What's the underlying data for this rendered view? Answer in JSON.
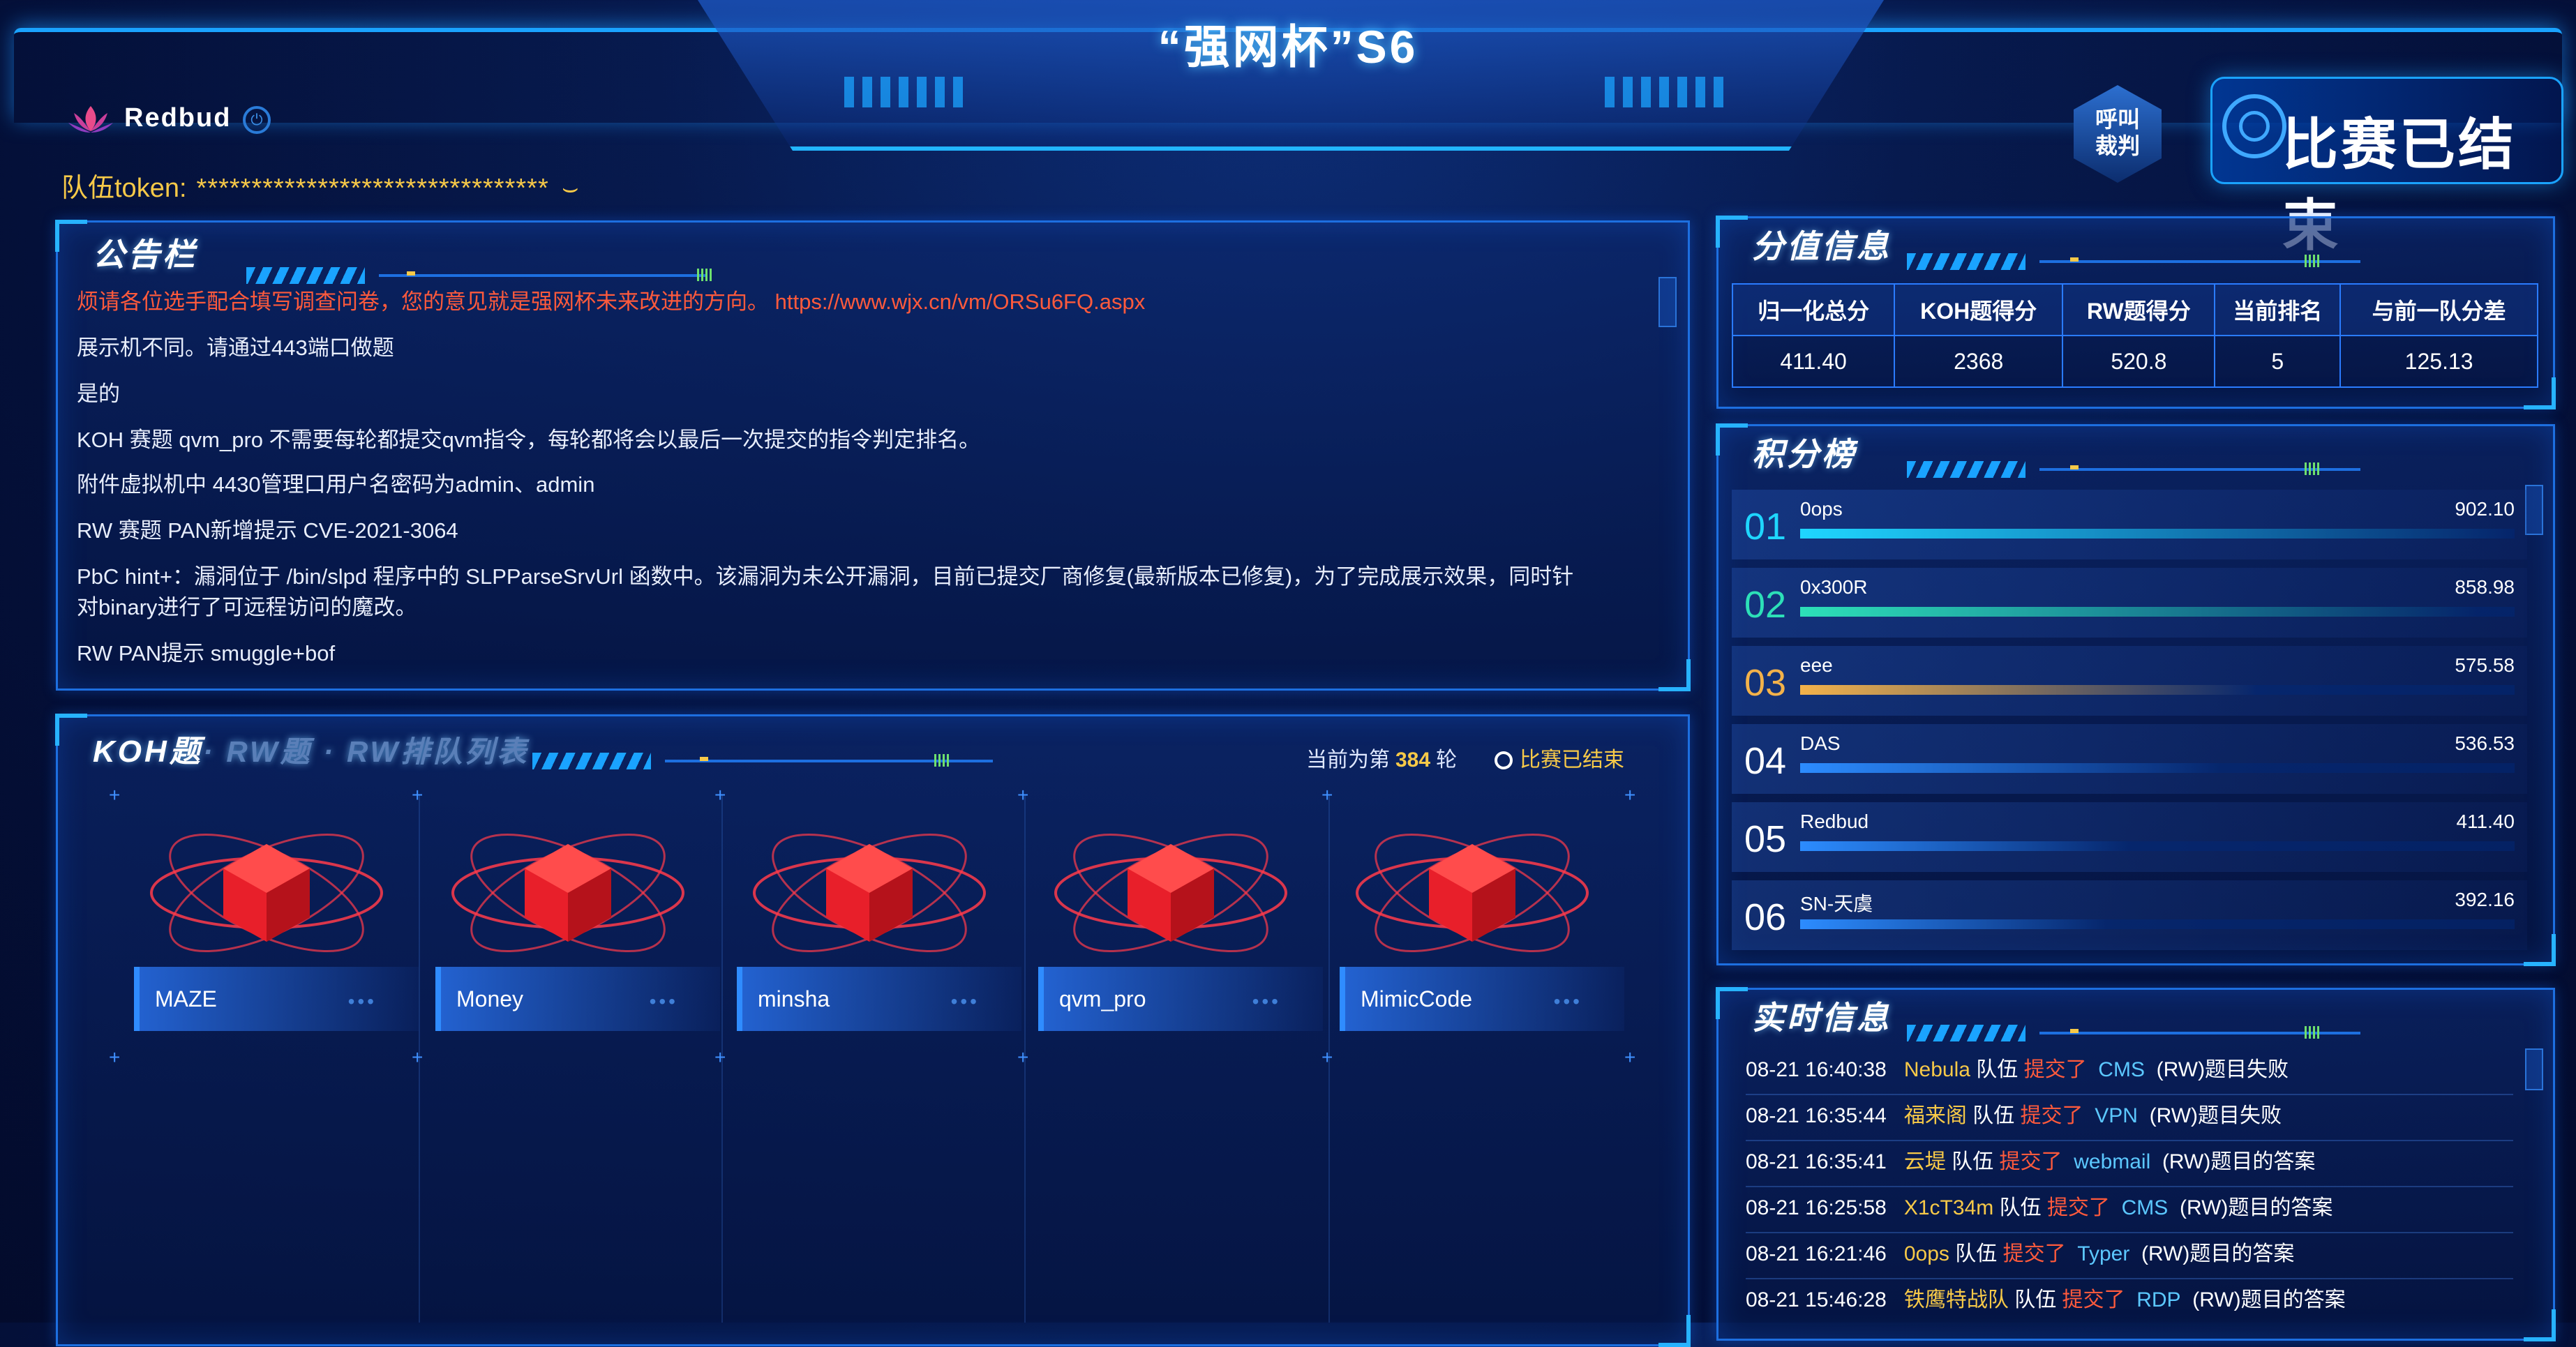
{
  "header": {
    "title": "“强网杯”S6",
    "team_name": "Redbud",
    "token_label": "队伍token:",
    "token_value": "********************************",
    "call_judge": [
      "呼叫",
      "裁判"
    ],
    "status": "比赛已结束"
  },
  "announcements": {
    "title": "公告栏",
    "items": [
      {
        "text": "烦请各位选手配合填写调查问卷，您的意见就是强网杯未来改进的方向。 https://www.wjx.cn/vm/ORSu6FQ.aspx",
        "highlight": true
      },
      {
        "text": "展示机不同。请通过443端口做题"
      },
      {
        "text": "是的"
      },
      {
        "text": "KOH 赛题 qvm_pro 不需要每轮都提交qvm指令，每轮都将会以最后一次提交的指令判定排名。"
      },
      {
        "text": "附件虚拟机中 4430管理口用户名密码为admin、admin"
      },
      {
        "text": "RW 赛题 PAN新增提示 CVE-2021-3064"
      },
      {
        "text": "PbC hint+：漏洞位于 /bin/slpd 程序中的 SLPParseSrvUrl 函数中。该漏洞为未公开漏洞，目前已提交厂商修复(最新版本已修复)，为了完成展示效果，同时针"
      },
      {
        "text": "对binary进行了可远程访问的魔改。"
      },
      {
        "text": "RW PAN提示 smuggle+bof"
      }
    ]
  },
  "score_info": {
    "title": "分值信息",
    "headers": [
      "归一化总分",
      "KOH题得分",
      "RW题得分",
      "当前排名",
      "与前一队分差"
    ],
    "values": [
      "411.40",
      "2368",
      "520.8",
      "5",
      "125.13"
    ]
  },
  "leaderboard": {
    "title": "积分榜",
    "rows": [
      {
        "rank": "01",
        "name": "0ops",
        "score": "902.10",
        "fraction": 1.0,
        "color": "#1fd6ff"
      },
      {
        "rank": "02",
        "name": "0x300R",
        "score": "858.98",
        "fraction": 0.95,
        "color": "#2de0b8"
      },
      {
        "rank": "03",
        "name": "eee",
        "score": "575.58",
        "fraction": 0.64,
        "color": "#f3b24a"
      },
      {
        "rank": "04",
        "name": "DAS",
        "score": "536.53",
        "fraction": 0.59,
        "color": "#2c8cff"
      },
      {
        "rank": "05",
        "name": "Redbud",
        "score": "411.40",
        "fraction": 0.46,
        "color": "#2c8cff"
      },
      {
        "rank": "06",
        "name": "SN-天虞",
        "score": "392.16",
        "fraction": 0.43,
        "color": "#2c8cff"
      }
    ]
  },
  "challenges": {
    "tab_active": "KOH题",
    "tab_others": "· RW题 · RW排队列表",
    "round_prefix": "当前为第",
    "round": "384",
    "round_suffix": "轮",
    "status": "比赛已结束",
    "items": [
      "MAZE",
      "Money",
      "minsha",
      "qvm_pro",
      "MimicCode"
    ]
  },
  "realtime": {
    "title": "实时信息",
    "items": [
      {
        "time": "08-21 16:40:38",
        "team": "Nebula",
        "mid": "队伍",
        "action": "提交了",
        "challenge": "CMS",
        "result": "(RW)题目失败"
      },
      {
        "time": "08-21 16:35:44",
        "team": "福来阁",
        "mid": "队伍",
        "action": "提交了",
        "challenge": "VPN",
        "result": "(RW)题目失败"
      },
      {
        "time": "08-21 16:35:41",
        "team": "云堤",
        "mid": "队伍",
        "action": "提交了",
        "challenge": "webmail",
        "result": "(RW)题目的答案"
      },
      {
        "time": "08-21 16:25:58",
        "team": "X1cT34m",
        "mid": "队伍",
        "action": "提交了",
        "challenge": "CMS",
        "result": "(RW)题目的答案"
      },
      {
        "time": "08-21 16:21:46",
        "team": "0ops",
        "mid": "队伍",
        "action": "提交了",
        "challenge": "Typer",
        "result": "(RW)题目的答案"
      },
      {
        "time": "08-21 15:46:28",
        "team": "铁鹰特战队",
        "mid": "队伍",
        "action": "提交了",
        "challenge": "RDP",
        "result": "(RW)题目的答案"
      }
    ]
  }
}
